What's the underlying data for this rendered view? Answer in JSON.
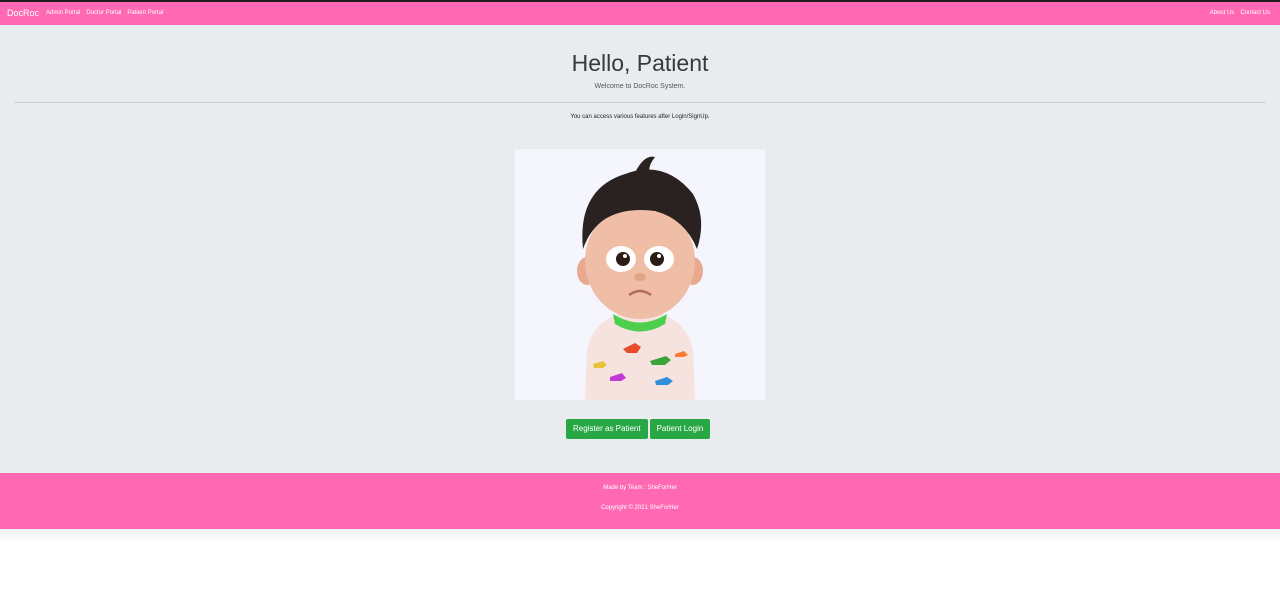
{
  "nav": {
    "brand": "DocRoc",
    "left_links": [
      "Admin Portal",
      "Doctor Portal",
      "Patient Portal"
    ],
    "right_links": [
      "About Us",
      "Contact Us"
    ]
  },
  "hero": {
    "title": "Hello, Patient",
    "subtitle": "Welcome to DocRoc System.",
    "info": "You can access various features after Login/SignUp."
  },
  "actions": {
    "register_label": "Register as Patient",
    "login_label": "Patient Login"
  },
  "footer": {
    "made_by": "Made by Team : SheForHer",
    "copyright": "Copyright © 2021 SheForHer"
  },
  "colors": {
    "brand_pink": "#ff69b4",
    "button_green": "#28a745",
    "jumbotron_bg": "#e9ecef"
  }
}
